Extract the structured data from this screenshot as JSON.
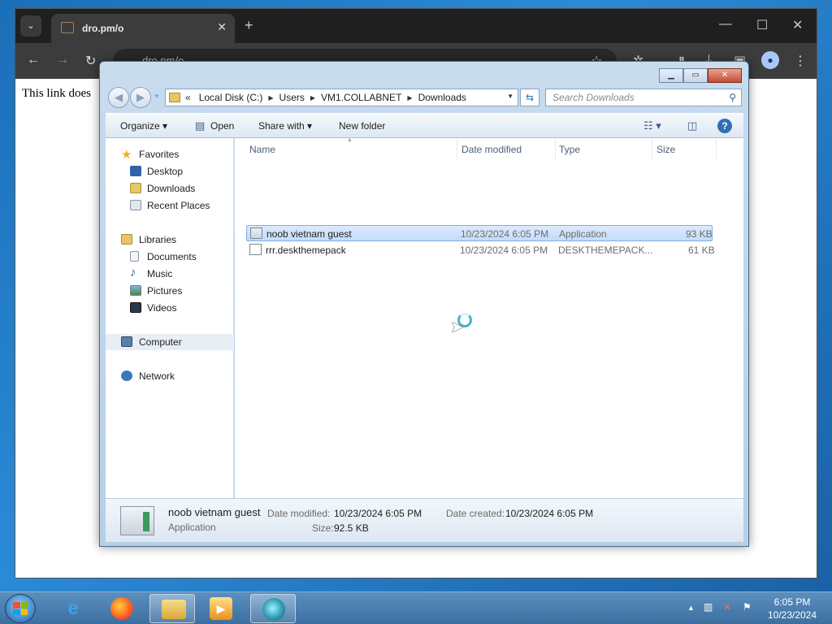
{
  "browser": {
    "tab_title": "dro.pm/o",
    "url": "dro.pm/o",
    "page_text": "This link does"
  },
  "explorer": {
    "breadcrumb": [
      "Local Disk (C:)",
      "Users",
      "VM1.COLLABNET",
      "Downloads"
    ],
    "search_placeholder": "Search Downloads",
    "toolbar": {
      "organize": "Organize",
      "open": "Open",
      "share_with": "Share with",
      "new_folder": "New folder"
    },
    "nav": {
      "favorites": "Favorites",
      "desktop": "Desktop",
      "downloads": "Downloads",
      "recent_places": "Recent Places",
      "libraries": "Libraries",
      "documents": "Documents",
      "music": "Music",
      "pictures": "Pictures",
      "videos": "Videos",
      "computer": "Computer",
      "network": "Network"
    },
    "columns": [
      "Name",
      "Date modified",
      "Type",
      "Size"
    ],
    "files": [
      {
        "name": "noob vietnam guest",
        "date": "10/23/2024 6:05 PM",
        "type": "Application",
        "size": "93 KB"
      },
      {
        "name": "rrr.deskthemepack",
        "date": "10/23/2024 6:05 PM",
        "type": "DESKTHEMEPACK...",
        "size": "61 KB"
      }
    ],
    "details": {
      "name": "noob vietnam guest",
      "type": "Application",
      "date_modified_label": "Date modified:",
      "date_modified": "10/23/2024 6:05 PM",
      "date_created_label": "Date created:",
      "date_created": "10/23/2024 6:05 PM",
      "size_label": "Size:",
      "size": "92.5 KB"
    }
  },
  "taskbar": {
    "time": "6:05 PM",
    "date": "10/23/2024"
  }
}
